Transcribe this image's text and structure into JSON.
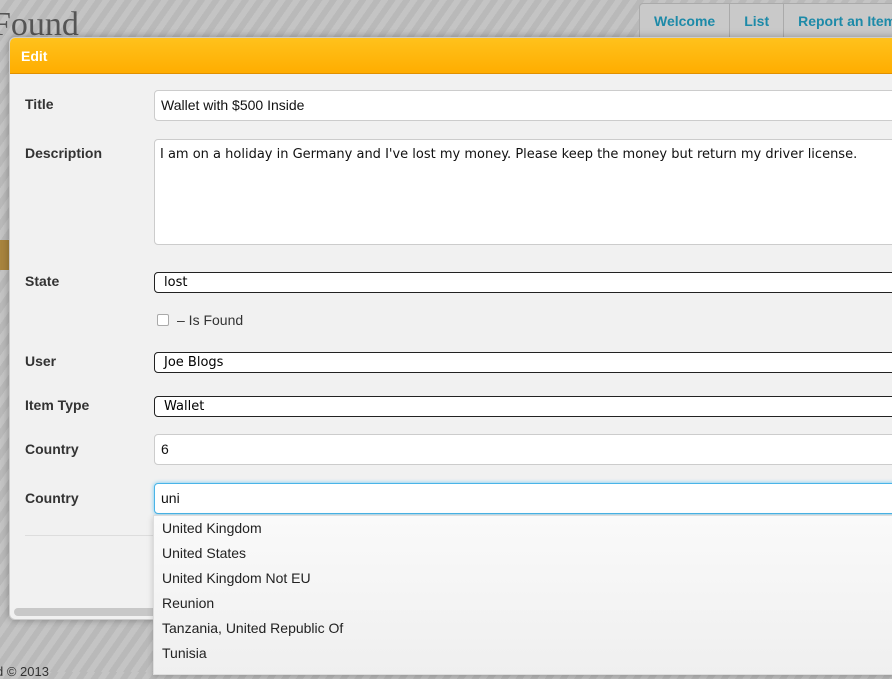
{
  "background": {
    "title": "Found",
    "nav": [
      "Welcome",
      "List",
      "Report an Item"
    ],
    "footer": "d © 2013"
  },
  "modal": {
    "title": "Edit",
    "labels": {
      "title": "Title",
      "description": "Description",
      "state": "State",
      "user": "User",
      "item_type": "Item Type",
      "country1": "Country",
      "country2": "Country"
    },
    "values": {
      "title": "Wallet with $500 Inside",
      "description": "I am on a holiday in Germany and I've lost my money. Please keep the money but return my driver license.",
      "state": "lost",
      "is_found_label": "– Is Found",
      "is_found": false,
      "user": "Joe Blogs",
      "item_type": "Wallet",
      "country_id": "6",
      "country_search": "uni"
    }
  },
  "autocomplete": [
    "United Kingdom",
    "United States",
    "United Kingdom Not EU",
    "Reunion",
    "Tanzania, United Republic Of",
    "Tunisia"
  ]
}
